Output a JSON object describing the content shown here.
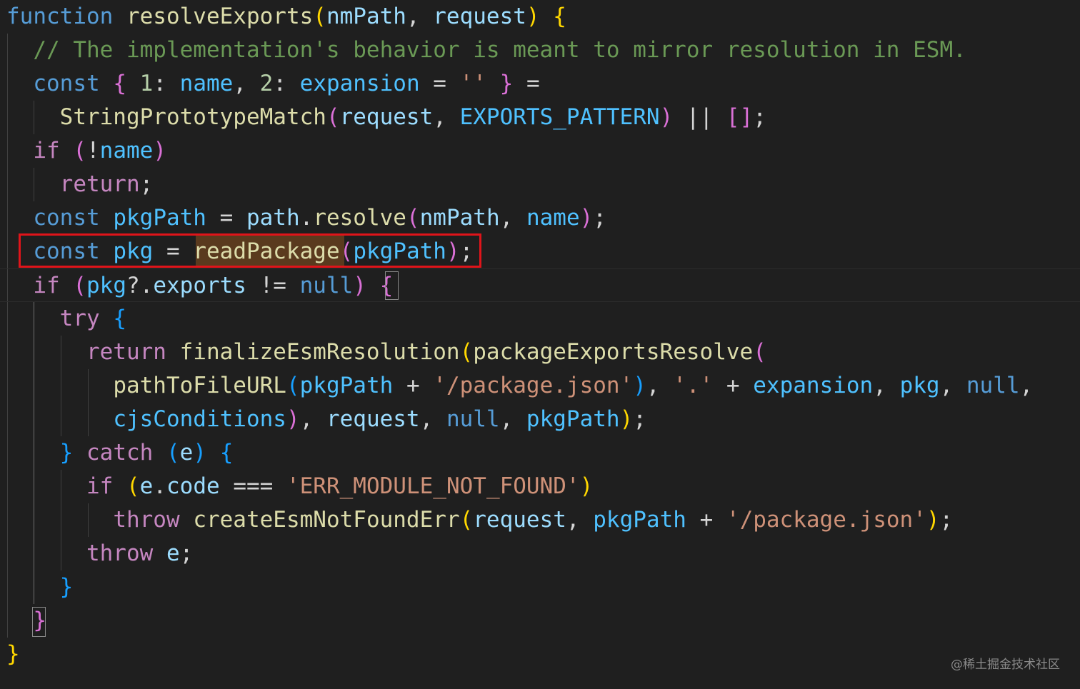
{
  "editor": {
    "lines": [
      [
        {
          "t": "function",
          "c": "k-decl"
        },
        {
          "t": " "
        },
        {
          "t": "resolveExports",
          "c": "fn"
        },
        {
          "t": "(",
          "c": "b-gold"
        },
        {
          "t": "nmPath",
          "c": "var"
        },
        {
          "t": ", "
        },
        {
          "t": "request",
          "c": "var"
        },
        {
          "t": ")",
          "c": "b-gold"
        },
        {
          "t": " "
        },
        {
          "t": "{",
          "c": "b-gold"
        }
      ],
      [
        {
          "t": "  "
        },
        {
          "t": "// The implementation's behavior is meant to mirror resolution in ESM.",
          "c": "cmt"
        }
      ],
      [
        {
          "t": "  "
        },
        {
          "t": "const",
          "c": "k-decl"
        },
        {
          "t": " "
        },
        {
          "t": "{",
          "c": "b-pink"
        },
        {
          "t": " "
        },
        {
          "t": "1",
          "c": "num"
        },
        {
          "t": ": "
        },
        {
          "t": "name",
          "c": "const"
        },
        {
          "t": ", "
        },
        {
          "t": "2",
          "c": "num"
        },
        {
          "t": ": "
        },
        {
          "t": "expansion",
          "c": "const"
        },
        {
          "t": " = "
        },
        {
          "t": "''",
          "c": "str"
        },
        {
          "t": " "
        },
        {
          "t": "}",
          "c": "b-pink"
        },
        {
          "t": " ="
        }
      ],
      [
        {
          "t": "    "
        },
        {
          "t": "StringPrototypeMatch",
          "c": "fn"
        },
        {
          "t": "(",
          "c": "b-pink"
        },
        {
          "t": "request",
          "c": "var"
        },
        {
          "t": ", "
        },
        {
          "t": "EXPORTS_PATTERN",
          "c": "const"
        },
        {
          "t": ")",
          "c": "b-pink"
        },
        {
          "t": " || "
        },
        {
          "t": "[]",
          "c": "b-pink"
        },
        {
          "t": ";"
        }
      ],
      [
        {
          "t": "  "
        },
        {
          "t": "if",
          "c": "k-ctrl"
        },
        {
          "t": " "
        },
        {
          "t": "(",
          "c": "b-pink"
        },
        {
          "t": "!"
        },
        {
          "t": "name",
          "c": "const"
        },
        {
          "t": ")",
          "c": "b-pink"
        }
      ],
      [
        {
          "t": "    "
        },
        {
          "t": "return",
          "c": "k-ctrl"
        },
        {
          "t": ";"
        }
      ],
      [
        {
          "t": "  "
        },
        {
          "t": "const",
          "c": "k-decl"
        },
        {
          "t": " "
        },
        {
          "t": "pkgPath",
          "c": "const"
        },
        {
          "t": " = "
        },
        {
          "t": "path",
          "c": "var"
        },
        {
          "t": "."
        },
        {
          "t": "resolve",
          "c": "fn"
        },
        {
          "t": "(",
          "c": "b-pink"
        },
        {
          "t": "nmPath",
          "c": "var"
        },
        {
          "t": ", "
        },
        {
          "t": "name",
          "c": "const"
        },
        {
          "t": ")",
          "c": "b-pink"
        },
        {
          "t": ";"
        }
      ],
      [
        {
          "t": "  "
        },
        {
          "t": "const",
          "c": "k-decl"
        },
        {
          "t": " "
        },
        {
          "t": "pkg",
          "c": "const"
        },
        {
          "t": " = "
        },
        {
          "t": "readPackage",
          "c": "fn"
        },
        {
          "t": "(",
          "c": "b-pink"
        },
        {
          "t": "pkgPath",
          "c": "const"
        },
        {
          "t": ")",
          "c": "b-pink"
        },
        {
          "t": ";"
        }
      ],
      [
        {
          "t": "  "
        },
        {
          "t": "if",
          "c": "k-ctrl"
        },
        {
          "t": " "
        },
        {
          "t": "(",
          "c": "b-pink"
        },
        {
          "t": "pkg",
          "c": "const"
        },
        {
          "t": "?."
        },
        {
          "t": "exports",
          "c": "var"
        },
        {
          "t": " != "
        },
        {
          "t": "null",
          "c": "k-decl"
        },
        {
          "t": ")",
          "c": "b-pink"
        },
        {
          "t": " "
        },
        {
          "t": "{",
          "c": "b-pink"
        }
      ],
      [
        {
          "t": "    "
        },
        {
          "t": "try",
          "c": "k-ctrl"
        },
        {
          "t": " "
        },
        {
          "t": "{",
          "c": "b-blue"
        }
      ],
      [
        {
          "t": "      "
        },
        {
          "t": "return",
          "c": "k-ctrl"
        },
        {
          "t": " "
        },
        {
          "t": "finalizeEsmResolution",
          "c": "fn"
        },
        {
          "t": "(",
          "c": "b-gold"
        },
        {
          "t": "packageExportsResolve",
          "c": "fn"
        },
        {
          "t": "(",
          "c": "b-pink"
        }
      ],
      [
        {
          "t": "        "
        },
        {
          "t": "pathToFileURL",
          "c": "fn"
        },
        {
          "t": "(",
          "c": "b-blue"
        },
        {
          "t": "pkgPath",
          "c": "const"
        },
        {
          "t": " + "
        },
        {
          "t": "'/package.json'",
          "c": "str"
        },
        {
          "t": ")",
          "c": "b-blue"
        },
        {
          "t": ", "
        },
        {
          "t": "'.'",
          "c": "str"
        },
        {
          "t": " + "
        },
        {
          "t": "expansion",
          "c": "const"
        },
        {
          "t": ", "
        },
        {
          "t": "pkg",
          "c": "const"
        },
        {
          "t": ", "
        },
        {
          "t": "null",
          "c": "k-decl"
        },
        {
          "t": ","
        }
      ],
      [
        {
          "t": "        "
        },
        {
          "t": "cjsConditions",
          "c": "const"
        },
        {
          "t": ")",
          "c": "b-pink"
        },
        {
          "t": ", "
        },
        {
          "t": "request",
          "c": "var"
        },
        {
          "t": ", "
        },
        {
          "t": "null",
          "c": "k-decl"
        },
        {
          "t": ", "
        },
        {
          "t": "pkgPath",
          "c": "const"
        },
        {
          "t": ")",
          "c": "b-gold"
        },
        {
          "t": ";"
        }
      ],
      [
        {
          "t": "    "
        },
        {
          "t": "}",
          "c": "b-blue"
        },
        {
          "t": " "
        },
        {
          "t": "catch",
          "c": "k-ctrl"
        },
        {
          "t": " "
        },
        {
          "t": "(",
          "c": "b-blue"
        },
        {
          "t": "e",
          "c": "var"
        },
        {
          "t": ")",
          "c": "b-blue"
        },
        {
          "t": " "
        },
        {
          "t": "{",
          "c": "b-blue"
        }
      ],
      [
        {
          "t": "      "
        },
        {
          "t": "if",
          "c": "k-ctrl"
        },
        {
          "t": " "
        },
        {
          "t": "(",
          "c": "b-gold"
        },
        {
          "t": "e",
          "c": "var"
        },
        {
          "t": "."
        },
        {
          "t": "code",
          "c": "var"
        },
        {
          "t": " === "
        },
        {
          "t": "'ERR_MODULE_NOT_FOUND'",
          "c": "str"
        },
        {
          "t": ")",
          "c": "b-gold"
        }
      ],
      [
        {
          "t": "        "
        },
        {
          "t": "throw",
          "c": "k-ctrl"
        },
        {
          "t": " "
        },
        {
          "t": "createEsmNotFoundErr",
          "c": "fn"
        },
        {
          "t": "(",
          "c": "b-gold"
        },
        {
          "t": "request",
          "c": "var"
        },
        {
          "t": ", "
        },
        {
          "t": "pkgPath",
          "c": "const"
        },
        {
          "t": " + "
        },
        {
          "t": "'/package.json'",
          "c": "str"
        },
        {
          "t": ")",
          "c": "b-gold"
        },
        {
          "t": ";"
        }
      ],
      [
        {
          "t": "      "
        },
        {
          "t": "throw",
          "c": "k-ctrl"
        },
        {
          "t": " "
        },
        {
          "t": "e",
          "c": "var"
        },
        {
          "t": ";"
        }
      ],
      [
        {
          "t": "    "
        },
        {
          "t": "}",
          "c": "b-blue"
        }
      ],
      [
        {
          "t": "  "
        },
        {
          "t": "}",
          "c": "b-pink"
        }
      ],
      [
        {
          "t": "}",
          "c": "b-gold"
        }
      ]
    ],
    "highlighted_line": 7,
    "current_line": 8,
    "theme": {
      "background": "#1f1f1f",
      "highlight_border": "#e0141a",
      "selection": "#5a3a1e"
    }
  },
  "watermark": "@稀土掘金技术社区"
}
